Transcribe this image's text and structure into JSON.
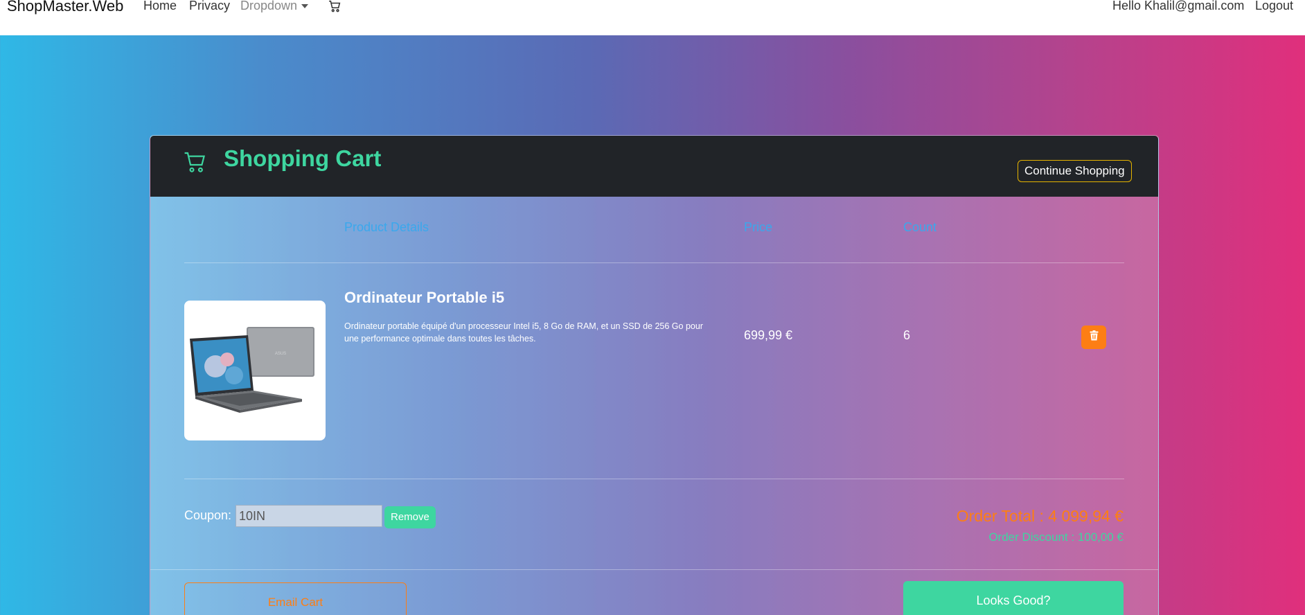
{
  "navbar": {
    "brand": "ShopMaster.Web",
    "links": [
      "Home",
      "Privacy",
      "Dropdown"
    ],
    "greeting": "Hello Khalil@gmail.com",
    "logout": "Logout"
  },
  "cart": {
    "title": "Shopping Cart",
    "continue_label": "Continue Shopping",
    "columns": {
      "details": "Product Details",
      "price": "Price",
      "count": "Count"
    },
    "items": [
      {
        "name": "Ordinateur Portable i5",
        "description": "Ordinateur portable équipé d'un processeur Intel i5, 8 Go de RAM, et un SSD de 256 Go pour une performance optimale dans toutes les tâches.",
        "price": "699,99 €",
        "count": "6"
      }
    ],
    "coupon": {
      "label": "Coupon:",
      "value": "10IN",
      "remove_label": "Remove"
    },
    "order_total": "Order Total : 4 099,94 €",
    "order_discount": "Order Discount : 100,00 €",
    "email_label": "Email Cart",
    "checkout_label": "Looks Good?"
  },
  "colors": {
    "accent_green": "#3ed6a0",
    "accent_orange": "#fd7e14",
    "header_dark": "#212428",
    "column_blue": "#3aa8ec"
  },
  "icons": [
    "cart-icon",
    "trash-icon",
    "laptop-image"
  ]
}
